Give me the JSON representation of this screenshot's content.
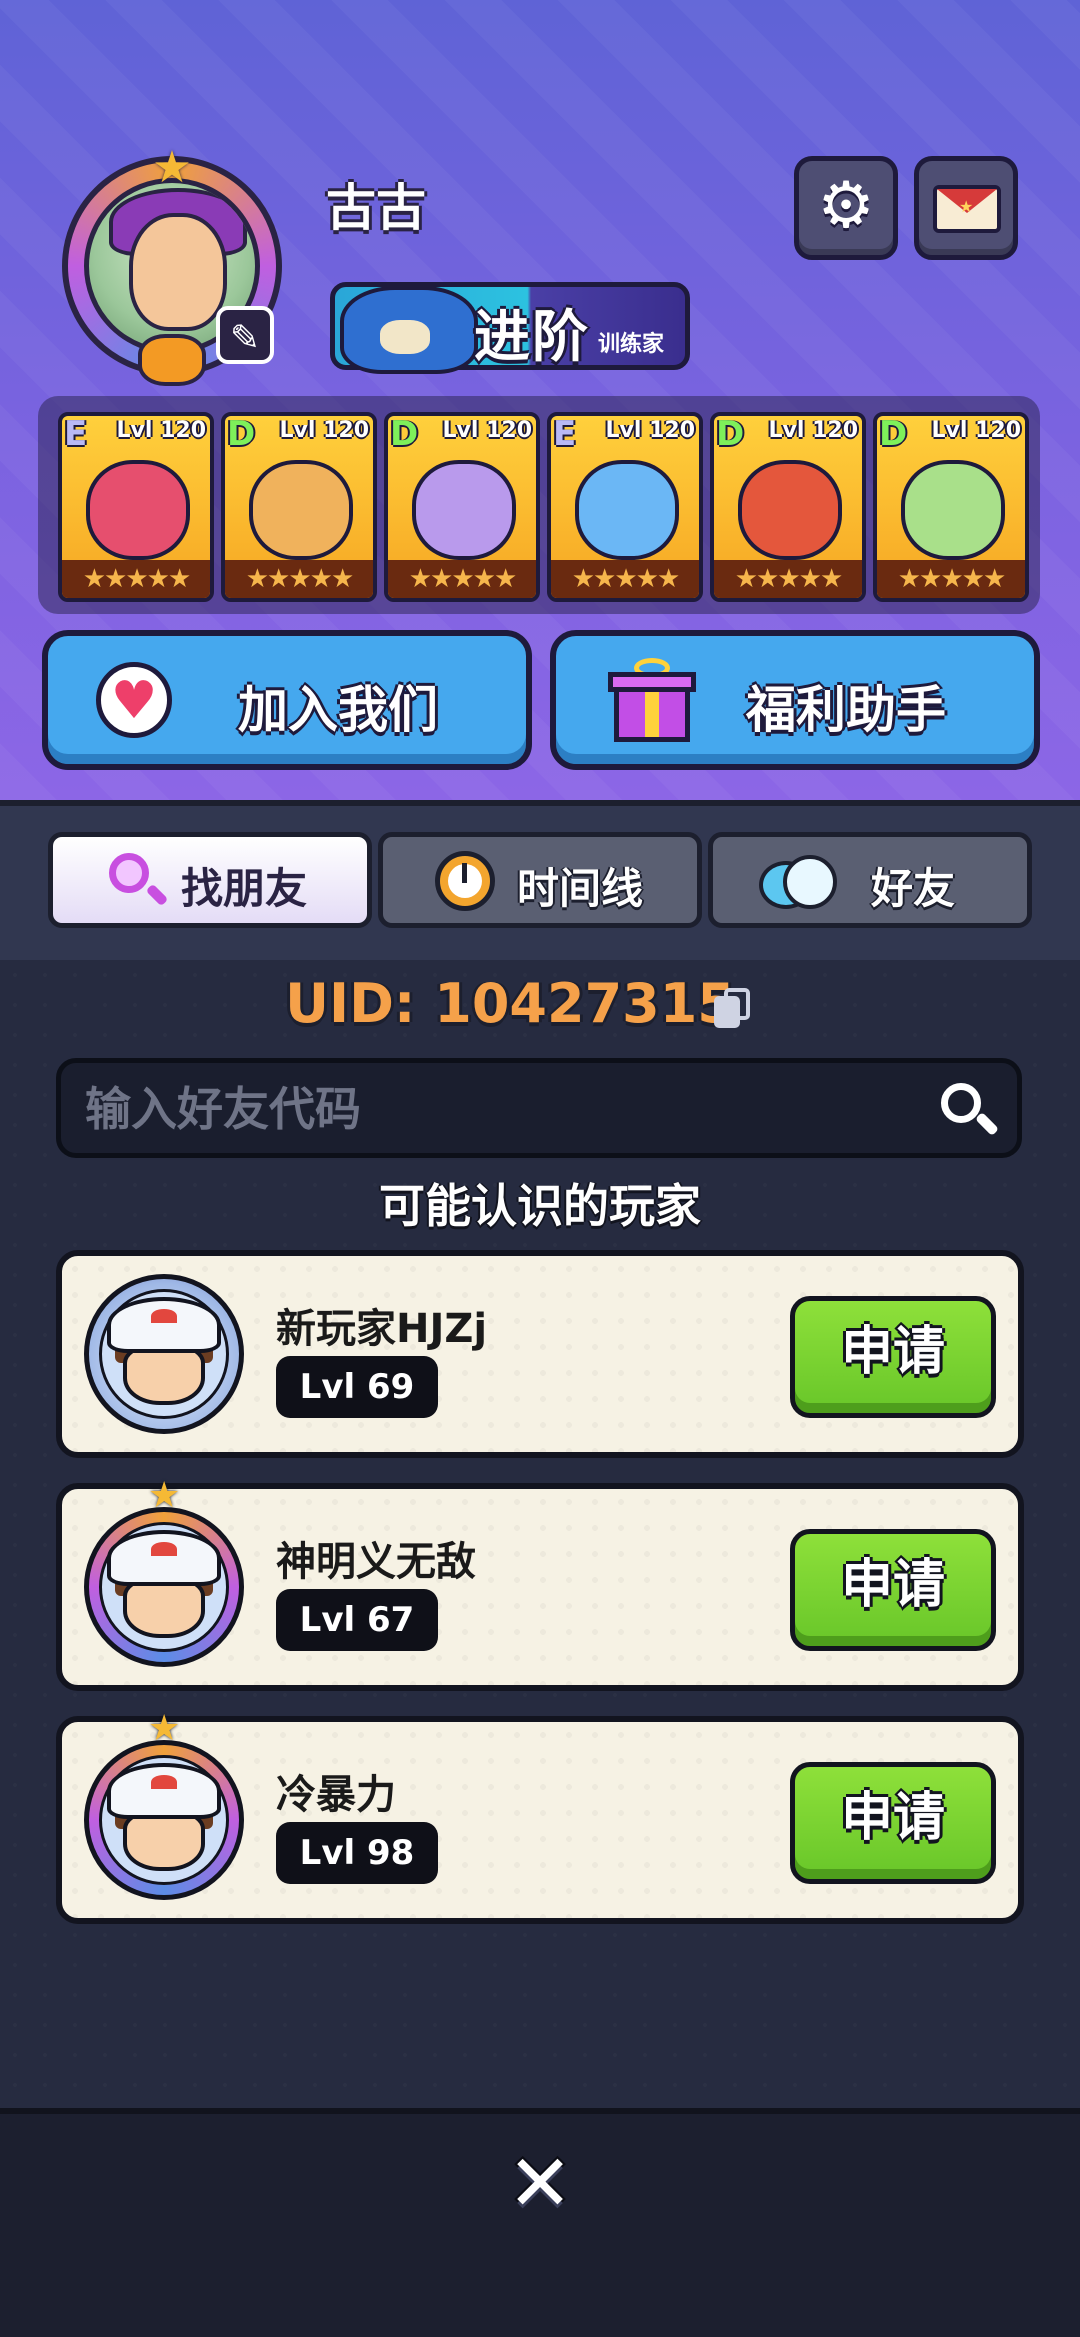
{
  "profile": {
    "name": "古古",
    "rank_label": "进阶",
    "rank_sub": "训练家"
  },
  "header": {
    "settings_icon": "gear-icon",
    "mail_icon": "mail-icon"
  },
  "pets": [
    {
      "grade": "E",
      "grade_color": "#b9b9f5",
      "level": "Lvl 120",
      "body_color": "#e64f6e"
    },
    {
      "grade": "D",
      "grade_color": "#7ef05a",
      "level": "Lvl 120",
      "body_color": "#f0b25c"
    },
    {
      "grade": "D",
      "grade_color": "#7ef05a",
      "level": "Lvl 120",
      "body_color": "#b99aec"
    },
    {
      "grade": "E",
      "grade_color": "#b9b9f5",
      "level": "Lvl 120",
      "body_color": "#6bb7f5"
    },
    {
      "grade": "D",
      "grade_color": "#7ef05a",
      "level": "Lvl 120",
      "body_color": "#e4573c"
    },
    {
      "grade": "D",
      "grade_color": "#7ef05a",
      "level": "Lvl 120",
      "body_color": "#a9e08a"
    }
  ],
  "pet_stars": "★★★★★",
  "actions": {
    "join_label": "加入我们",
    "welfare_label": "福利助手"
  },
  "tabs": [
    {
      "label": "找朋友",
      "active": true
    },
    {
      "label": "时间线",
      "active": false
    },
    {
      "label": "好友",
      "active": false
    }
  ],
  "uid": "UID: 10427315",
  "search": {
    "placeholder": "输入好友代码",
    "value": ""
  },
  "suggest_title": "可能认识的玩家",
  "players": [
    {
      "name": "新玩家HJZj",
      "level": "Lvl 69",
      "button": "申请"
    },
    {
      "name": "神明义无敌",
      "level": "Lvl 67",
      "button": "申请"
    },
    {
      "name": "冷暴力",
      "level": "Lvl 98",
      "button": "申请"
    }
  ],
  "close_icon": "close-icon"
}
